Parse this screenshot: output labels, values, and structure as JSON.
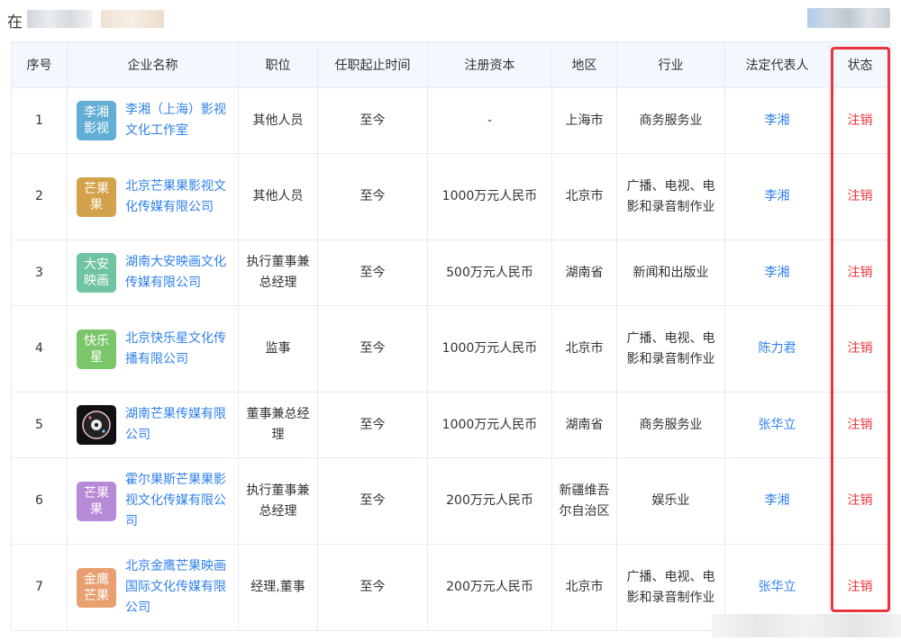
{
  "header": {
    "title_char": "在"
  },
  "table": {
    "columns": [
      "序号",
      "企业名称",
      "职位",
      "任职起止时间",
      "注册资本",
      "地区",
      "行业",
      "法定代表人",
      "状态"
    ],
    "rows": [
      {
        "index": "1",
        "logo_text": "李湘影视",
        "logo_color": "#62aed5",
        "logo_type": "text",
        "company": "李湘（上海）影视文化工作室",
        "position": "其他人员",
        "period": "至今",
        "capital": "-",
        "region": "上海市",
        "industry": "商务服务业",
        "legal_rep": "李湘",
        "status": "注销"
      },
      {
        "index": "2",
        "logo_text": "芒果果",
        "logo_color": "#d4a24a",
        "logo_type": "text",
        "company": "北京芒果果影视文化传媒有限公司",
        "position": "其他人员",
        "period": "至今",
        "capital": "1000万元人民币",
        "region": "北京市",
        "industry": "广播、电视、电影和录音制作业",
        "legal_rep": "李湘",
        "status": "注销"
      },
      {
        "index": "3",
        "logo_text": "大安映画",
        "logo_color": "#6fc4a2",
        "logo_type": "text",
        "company": "湖南大安映画文化传媒有限公司",
        "position": "执行董事兼总经理",
        "period": "至今",
        "capital": "500万元人民币",
        "region": "湖南省",
        "industry": "新闻和出版业",
        "legal_rep": "李湘",
        "status": "注销"
      },
      {
        "index": "4",
        "logo_text": "快乐星",
        "logo_color": "#7bc66a",
        "logo_type": "text",
        "company": "北京快乐星文化传播有限公司",
        "position": "监事",
        "period": "至今",
        "capital": "1000万元人民币",
        "region": "北京市",
        "industry": "广播、电视、电影和录音制作业",
        "legal_rep": "陈力君",
        "status": "注销"
      },
      {
        "index": "5",
        "logo_text": "",
        "logo_color": "#111111",
        "logo_type": "image",
        "company": "湖南芒果传媒有限公司",
        "position": "董事兼总经理",
        "period": "至今",
        "capital": "1000万元人民币",
        "region": "湖南省",
        "industry": "商务服务业",
        "legal_rep": "张华立",
        "status": "注销"
      },
      {
        "index": "6",
        "logo_text": "芒果果",
        "logo_color": "#b78ad8",
        "logo_type": "text",
        "company": "霍尔果斯芒果果影视文化传媒有限公司",
        "position": "执行董事兼总经理",
        "period": "至今",
        "capital": "200万元人民币",
        "region": "新疆维吾尔自治区",
        "industry": "娱乐业",
        "legal_rep": "李湘",
        "status": "注销"
      },
      {
        "index": "7",
        "logo_text": "金鹰芒果",
        "logo_color": "#e8a070",
        "logo_type": "text",
        "company": "北京金鹰芒果映画国际文化传媒有限公司",
        "position": "经理,董事",
        "period": "至今",
        "capital": "200万元人民币",
        "region": "北京市",
        "industry": "广播、电视、电影和录音制作业",
        "legal_rep": "张华立",
        "status": "注销"
      }
    ]
  }
}
